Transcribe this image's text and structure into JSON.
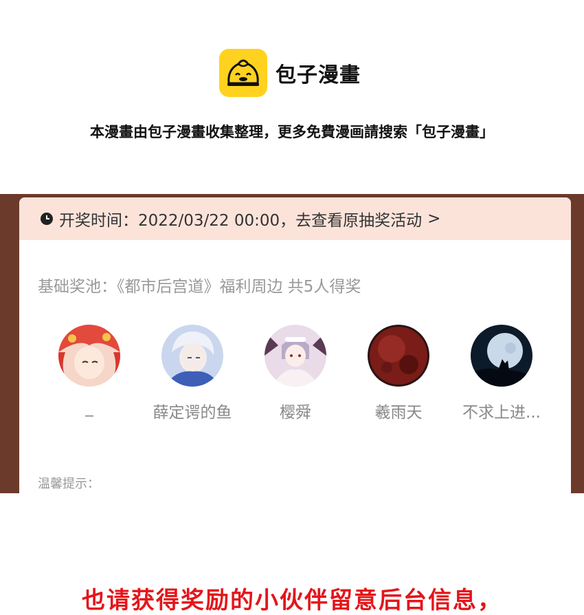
{
  "brand": {
    "icon": "bun-face-icon",
    "name": "包子漫畫",
    "accent_color": "#ffd21f"
  },
  "notice": "本漫畫由包子漫畫收集整理，更多免費漫画請搜索「包子漫畫」",
  "lottery": {
    "header_icon": "clock-icon",
    "draw_time": "开奖时间：2022/03/22 00:00，去查看原抽奖活动",
    "chevron": ">",
    "pool": "基础奖池：《都市后宫道》福利周边 共5人得奖",
    "winners": [
      {
        "name": "_",
        "avatar": "anime-girl-avatar"
      },
      {
        "name": "薛定谔的鱼",
        "avatar": "anime-boy-avatar"
      },
      {
        "name": "樱舜",
        "avatar": "maid-girl-avatar"
      },
      {
        "name": "羲雨天",
        "avatar": "red-moon-avatar"
      },
      {
        "name": "不求上进...",
        "avatar": "wolf-moon-avatar"
      }
    ],
    "tip_label": "温馨提示："
  },
  "footer": "也请获得奖励的小伙伴留意后台信息，",
  "colors": {
    "panel_brown": "#6b3a2a",
    "header_pink": "#fce3da",
    "footer_red": "#e3161b"
  }
}
